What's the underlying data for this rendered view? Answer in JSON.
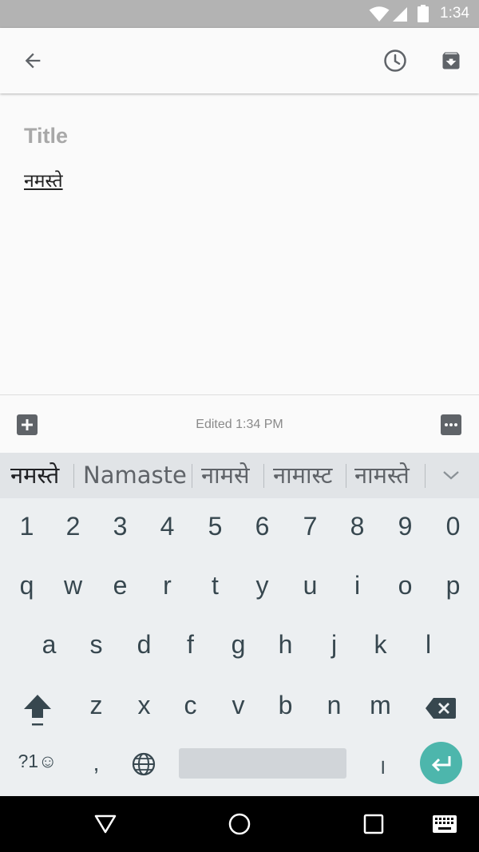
{
  "status_bar": {
    "time": "1:34"
  },
  "note": {
    "title_placeholder": "Title",
    "body_text": "नमस्ते",
    "edited": "Edited 1:34 PM"
  },
  "keyboard": {
    "suggestions": [
      "नमस्ते",
      "Namaste",
      "नामसे",
      "नामास्ट",
      "नामस्ते"
    ],
    "number_row": [
      "1",
      "2",
      "3",
      "4",
      "5",
      "6",
      "7",
      "8",
      "9",
      "0"
    ],
    "row1": [
      "q",
      "w",
      "e",
      "r",
      "t",
      "y",
      "u",
      "i",
      "o",
      "p"
    ],
    "row2": [
      "a",
      "s",
      "d",
      "f",
      "g",
      "h",
      "j",
      "k",
      "l"
    ],
    "row3": [
      "z",
      "x",
      "c",
      "v",
      "b",
      "n",
      "m"
    ],
    "symbols_label": "?1☺",
    "comma": ",",
    "danda": "।"
  },
  "colors": {
    "status_bar": "#b3b3b3",
    "keyboard_bg": "#eceff1",
    "suggestion_bg": "#e1e4e7",
    "enter_key": "#4db6ac",
    "key_text": "#37474f"
  }
}
